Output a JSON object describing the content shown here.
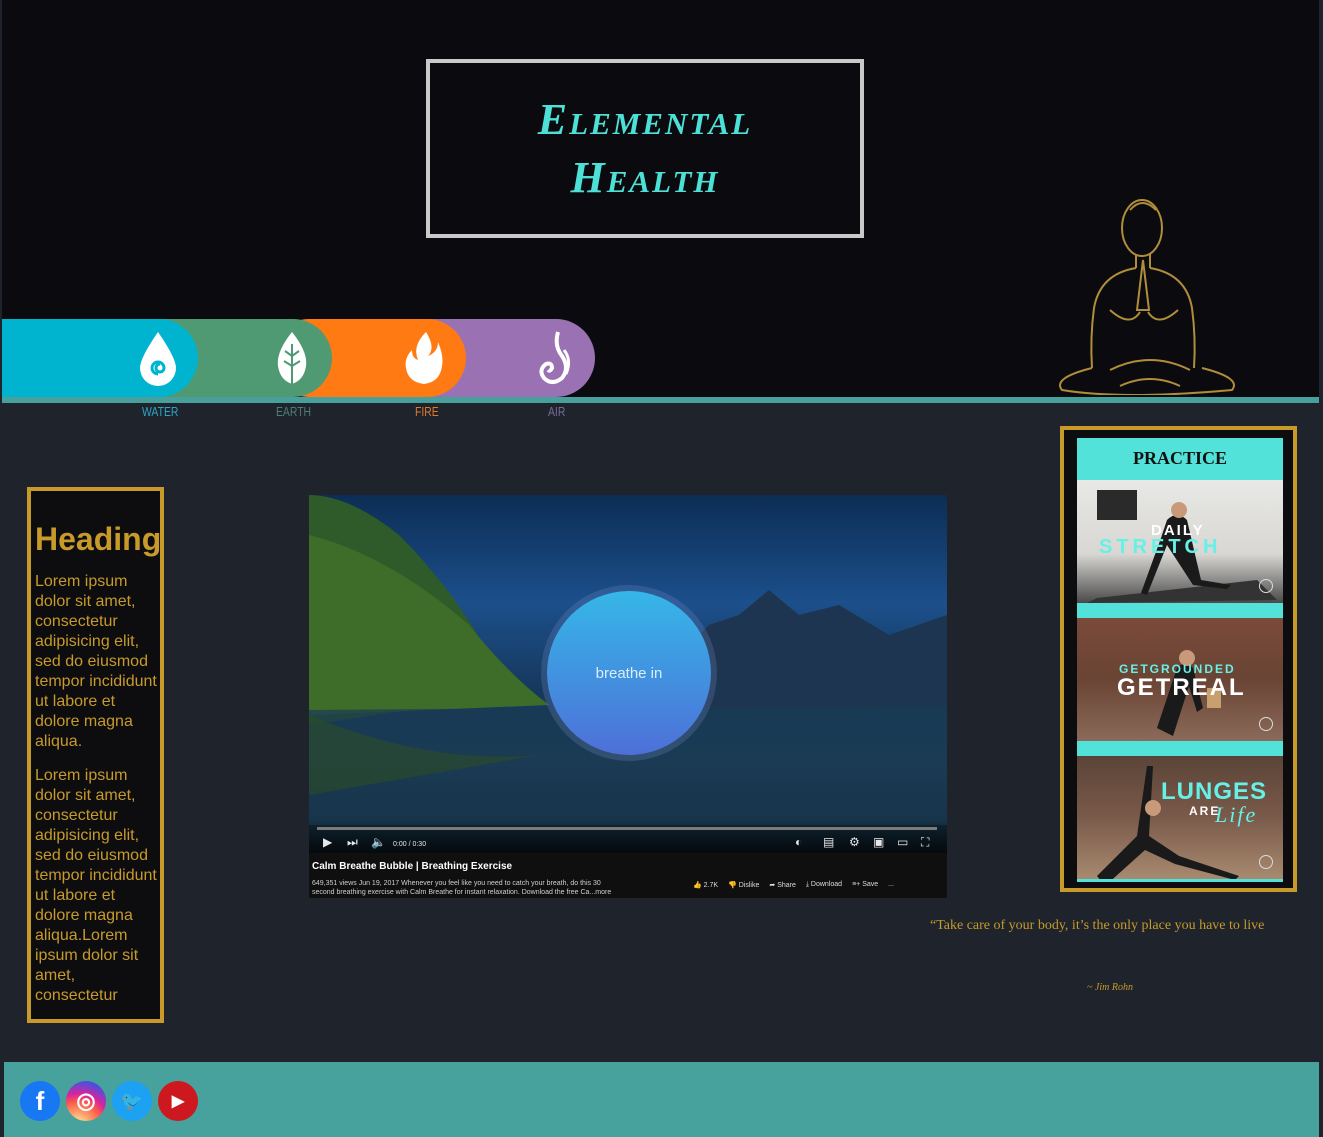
{
  "header": {
    "title_line1": "Elemental",
    "title_line2": "Health"
  },
  "elements": [
    {
      "label": "WATER",
      "color": "#00b4d0",
      "label_color": "#2aa6c6",
      "icon": "water-drop-icon"
    },
    {
      "label": "EARTH",
      "color": "#4f9a72",
      "label_color": "#4f7f70",
      "icon": "leaf-icon"
    },
    {
      "label": "FIRE",
      "color": "#ff7a12",
      "label_color": "#e07a2a",
      "icon": "flame-icon"
    },
    {
      "label": "AIR",
      "color": "#9a72b3",
      "label_color": "#7a6a98",
      "icon": "air-swirl-icon"
    }
  ],
  "sidebar": {
    "heading": "Heading",
    "para1": "Lorem ipsum dolor sit amet, consectetur adipisicing elit, sed do eiusmod tempor incididunt ut labore et dolore magna aliqua.",
    "para2": "Lorem ipsum dolor sit amet, consectetur adipisicing elit, sed do eiusmod tempor incididunt ut labore et dolore magna aliqua.Lorem ipsum dolor sit amet, consectetur"
  },
  "video": {
    "overlay_text": "breathe in",
    "time": "0:00 / 0:30",
    "title": "Calm Breathe Bubble | Breathing Exercise",
    "meta": "649,351 views  Jun 19, 2017  Whenever you feel like you need to catch your breath, do this 30 second breathing exercise with Calm Breathe for instant relaxation. Download the free Ca...more",
    "likes": "2.7K",
    "dislike": "Dislike",
    "share": "Share",
    "download": "Download",
    "save": "Save",
    "more": "..."
  },
  "practice": {
    "title": "PRACTICE",
    "items": [
      {
        "line1": "DAILY",
        "line2": "STRETCH"
      },
      {
        "line1": "GETGROUNDED",
        "line2": "GETREAL"
      },
      {
        "line1": "LUNGES",
        "line2": "ARE",
        "line3": "Life"
      }
    ]
  },
  "quote": {
    "text": "“Take care of your body, it’s the only place you have to live",
    "author": "~ Jim Rohn"
  },
  "footer": {
    "socials": [
      {
        "name": "facebook",
        "glyph": "f",
        "color": "#1877f2"
      },
      {
        "name": "instagram",
        "glyph": "◎",
        "color": "#d6249f"
      },
      {
        "name": "twitter",
        "glyph": "🐦",
        "color": "#1da1f2"
      },
      {
        "name": "youtube",
        "glyph": "▶",
        "color": "#cc181e"
      }
    ]
  },
  "colors": {
    "accent_teal": "#4de0d6",
    "gold": "#c79a2a",
    "footer_teal": "#47a29e"
  }
}
